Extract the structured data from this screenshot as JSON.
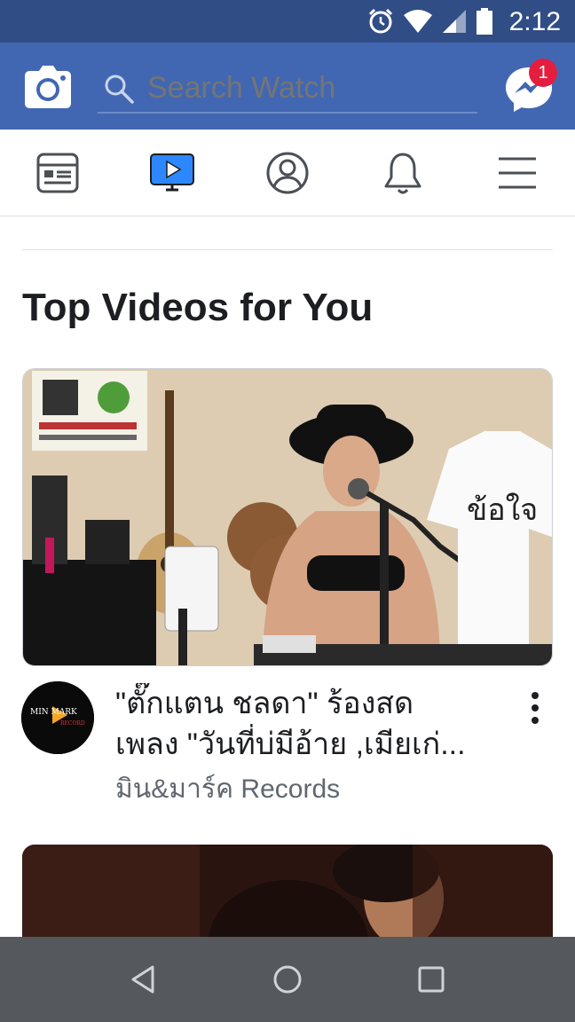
{
  "status_bar": {
    "time": "2:12",
    "icons": [
      "alarm-icon",
      "wifi-icon",
      "signal-icon",
      "battery-icon"
    ]
  },
  "header": {
    "search_placeholder": "Search Watch",
    "messenger_badge": "1",
    "colors": {
      "brand": "#4267b2",
      "status_bar": "#314d86",
      "badge": "#e41e3f"
    }
  },
  "tabs": [
    {
      "name": "news-feed",
      "icon": "news-feed-icon",
      "active": false
    },
    {
      "name": "watch",
      "icon": "watch-video-icon",
      "active": true
    },
    {
      "name": "profile",
      "icon": "profile-icon",
      "active": false
    },
    {
      "name": "notifications",
      "icon": "bell-icon",
      "active": false
    },
    {
      "name": "menu",
      "icon": "hamburger-menu-icon",
      "active": false
    }
  ],
  "section": {
    "title": "Top Videos for You"
  },
  "videos": [
    {
      "title_line1": "\"ตั๊กแตน ชลดา\" ร้องสด",
      "title_line2": "เพลง \"วันที่บ่มีอ้าย ,เมียเก่...",
      "channel": "มิน&มาร์ค Records",
      "avatar_text_top": "MIN MARK",
      "avatar_text_bottom": "RECORD"
    }
  ],
  "nav": {
    "buttons": [
      "back-icon",
      "home-icon",
      "recents-icon"
    ]
  }
}
